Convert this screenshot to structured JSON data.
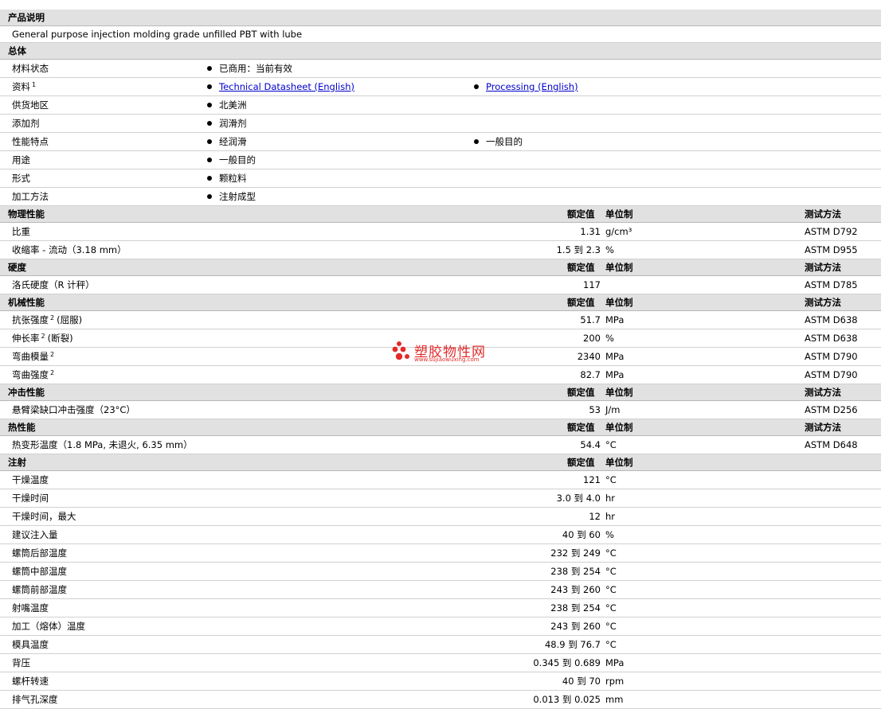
{
  "description": {
    "section": "产品说明",
    "text": "General purpose injection molding grade unfilled PBT with lube"
  },
  "general": {
    "section": "总体",
    "rows": [
      {
        "label": "材料状态",
        "sup": "",
        "items": [
          "已商用：当前有效"
        ]
      },
      {
        "label": "资料",
        "sup": "1",
        "items": [
          "Technical Datasheet (English)",
          "Processing (English)"
        ]
      },
      {
        "label": "供货地区",
        "sup": "",
        "items": [
          "北美洲"
        ]
      },
      {
        "label": "添加剂",
        "sup": "",
        "items": [
          "润滑剂"
        ]
      },
      {
        "label": "性能特点",
        "sup": "",
        "items": [
          "经润滑",
          "一般目的"
        ]
      },
      {
        "label": "用途",
        "sup": "",
        "items": [
          "一般目的"
        ]
      },
      {
        "label": "形式",
        "sup": "",
        "items": [
          "颗粒料"
        ]
      },
      {
        "label": "加工方法",
        "sup": "",
        "items": [
          "注射成型"
        ]
      }
    ]
  },
  "headers": {
    "nominal": "额定值",
    "unit": "单位制",
    "method": "测试方法"
  },
  "sections": [
    {
      "title": "物理性能",
      "show_method": true,
      "rows": [
        {
          "label": "比重",
          "sup": "",
          "value": "1.31",
          "unit": "g/cm³",
          "method": "ASTM D792"
        },
        {
          "label": "收缩率  - 流动（3.18 mm）",
          "sup": "",
          "value": "1.5 到  2.3",
          "unit": "%",
          "method": "ASTM D955"
        }
      ]
    },
    {
      "title": "硬度",
      "show_method": true,
      "rows": [
        {
          "label": "洛氏硬度（R 计秤）",
          "sup": "",
          "value": "117",
          "unit": "",
          "method": "ASTM D785"
        }
      ]
    },
    {
      "title": "机械性能",
      "show_method": true,
      "rows": [
        {
          "label": "抗张强度",
          "sup": "2",
          "suffix": "(屈服)",
          "value": "51.7",
          "unit": "MPa",
          "method": "ASTM D638"
        },
        {
          "label": "伸长率",
          "sup": "2",
          "suffix": "(断裂)",
          "value": "200",
          "unit": "%",
          "method": "ASTM D638"
        },
        {
          "label": "弯曲模量",
          "sup": "2",
          "suffix": "",
          "value": "2340",
          "unit": "MPa",
          "method": "ASTM D790"
        },
        {
          "label": "弯曲强度",
          "sup": "2",
          "suffix": "",
          "value": "82.7",
          "unit": "MPa",
          "method": "ASTM D790"
        }
      ]
    },
    {
      "title": "冲击性能",
      "show_method": true,
      "rows": [
        {
          "label": "悬臂梁缺口冲击强度（23°C）",
          "sup": "",
          "value": "53",
          "unit": "J/m",
          "method": "ASTM D256"
        }
      ]
    },
    {
      "title": "热性能",
      "show_method": true,
      "rows": [
        {
          "label": "热变形温度（1.8 MPa, 未退火, 6.35 mm）",
          "sup": "",
          "value": "54.4",
          "unit": "°C",
          "method": "ASTM D648"
        }
      ]
    },
    {
      "title": "注射",
      "show_method": false,
      "rows": [
        {
          "label": "干燥温度",
          "sup": "",
          "value": "121",
          "unit": "°C",
          "method": ""
        },
        {
          "label": "干燥时间",
          "sup": "",
          "value": "3.0 到  4.0",
          "unit": "hr",
          "method": ""
        },
        {
          "label": "干燥时间，最大",
          "sup": "",
          "value": "12",
          "unit": "hr",
          "method": ""
        },
        {
          "label": "建议注入量",
          "sup": "",
          "value": "40 到  60",
          "unit": "%",
          "method": ""
        },
        {
          "label": "螺筒后部温度",
          "sup": "",
          "value": "232 到  249",
          "unit": "°C",
          "method": ""
        },
        {
          "label": "螺筒中部温度",
          "sup": "",
          "value": "238 到  254",
          "unit": "°C",
          "method": ""
        },
        {
          "label": "螺筒前部温度",
          "sup": "",
          "value": "243 到  260",
          "unit": "°C",
          "method": ""
        },
        {
          "label": "射嘴温度",
          "sup": "",
          "value": "238 到  254",
          "unit": "°C",
          "method": ""
        },
        {
          "label": "加工（熔体）温度",
          "sup": "",
          "value": "243 到  260",
          "unit": "°C",
          "method": ""
        },
        {
          "label": "模具温度",
          "sup": "",
          "value": "48.9 到  76.7",
          "unit": "°C",
          "method": ""
        },
        {
          "label": "背压",
          "sup": "",
          "value": "0.345 到  0.689",
          "unit": "MPa",
          "method": ""
        },
        {
          "label": "螺杆转速",
          "sup": "",
          "value": "40 到  70",
          "unit": "rpm",
          "method": ""
        },
        {
          "label": "排气孔深度",
          "sup": "",
          "value": "0.013 到  0.025",
          "unit": "mm",
          "method": ""
        }
      ]
    }
  ],
  "watermark": {
    "title": "塑胶物性网",
    "url": "www.sujiaowuxing.com",
    "color": "#e12b2b"
  }
}
